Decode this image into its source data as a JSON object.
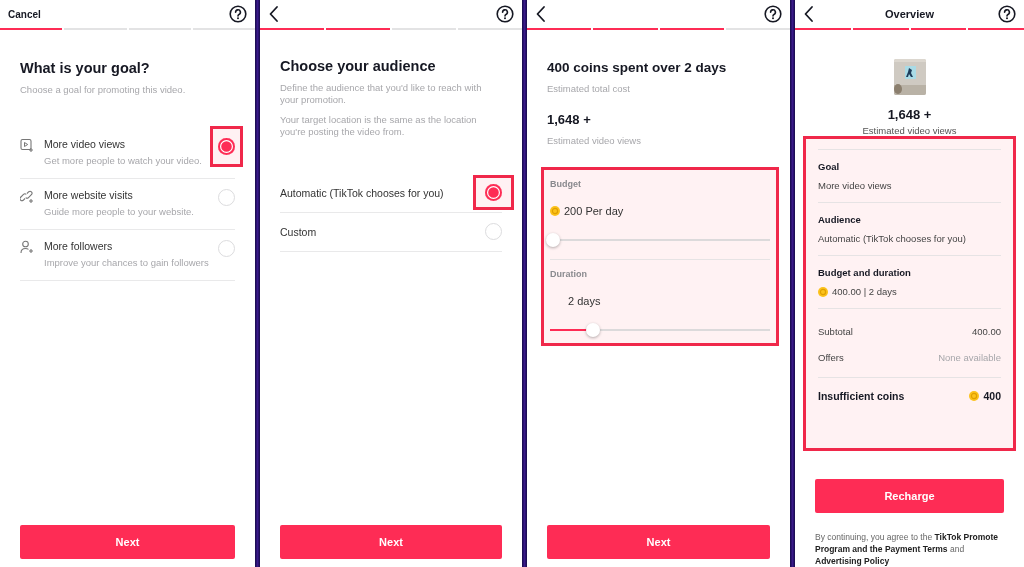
{
  "screens": [
    {
      "kind": "goal",
      "header": {
        "kind": "cancel",
        "label": "Cancel"
      },
      "steps": [
        {
          "done": true
        },
        {
          "done": false
        },
        {
          "done": false
        },
        {
          "done": false
        }
      ],
      "title": "What is your goal?",
      "subtitle": "Choose a goal for promoting this video.",
      "options": [
        {
          "kind": "video",
          "label": "More video views",
          "description": "Get more people to watch your video.",
          "selected": true,
          "highlighted": true
        },
        {
          "kind": "website",
          "label": "More website visits",
          "description": "Guide more people to your website.",
          "selected": false,
          "highlighted": false
        },
        {
          "kind": "followers",
          "label": "More followers",
          "description": "Improve your chances to gain followers",
          "selected": false,
          "highlighted": false
        }
      ],
      "button": "Next"
    },
    {
      "kind": "audience",
      "header": {
        "kind": "back"
      },
      "steps": [
        {
          "done": true
        },
        {
          "done": true
        },
        {
          "done": false
        },
        {
          "done": false
        }
      ],
      "title": "Choose your audience",
      "paragraphs": [
        "Define the audience that you'd like to reach with your promotion.",
        "Your target location is the same as the location you're posting the video from."
      ],
      "options": [
        {
          "label": "Automatic (TikTok chooses for you)",
          "selected": true,
          "highlighted": true
        },
        {
          "label": "Custom",
          "selected": false,
          "highlighted": false
        }
      ],
      "button": "Next"
    },
    {
      "kind": "budget",
      "header": {
        "kind": "back"
      },
      "steps": [
        {
          "done": true
        },
        {
          "done": true
        },
        {
          "done": true
        },
        {
          "done": false
        }
      ],
      "title": "400 coins spent over 2 days",
      "subtitle": "Estimated total cost",
      "views": "1,648 +",
      "views_label": "Estimated video views",
      "highlighted": true,
      "sliders": [
        {
          "label": "Budget",
          "value": "200 Per day",
          "coin": true,
          "level": 0
        },
        {
          "label": "Duration",
          "value": "2 days",
          "coin": false,
          "level": 0.18
        }
      ],
      "button": "Next"
    },
    {
      "kind": "overview",
      "header": {
        "kind": "back",
        "title": "Overview"
      },
      "steps": [
        {
          "done": true
        },
        {
          "done": true
        },
        {
          "done": true
        },
        {
          "done": true
        }
      ],
      "thumbnail": {
        "kind": "picture"
      },
      "views": "1,648 +",
      "views_label": "Estimated video views",
      "highlighted": true,
      "sections": [
        {
          "label": "Goal",
          "value": "More video views",
          "coin": false
        },
        {
          "label": "Audience",
          "value": "Automatic (TikTok chooses for you)",
          "coin": false
        },
        {
          "label": "Budget and duration",
          "value": "400.00 | 2 days",
          "coin": true
        }
      ],
      "rows": [
        {
          "label": "Subtotal",
          "value": "400.00",
          "muted": false
        },
        {
          "label": "Offers",
          "value": "None available",
          "muted": true
        }
      ],
      "total": {
        "label": "Insufficient coins",
        "value": "400"
      },
      "button": "Recharge",
      "legal": "By continuing, you agree to the **TikTok Promote Program and the Payment Terms** and **Advertising Policy**"
    }
  ]
}
